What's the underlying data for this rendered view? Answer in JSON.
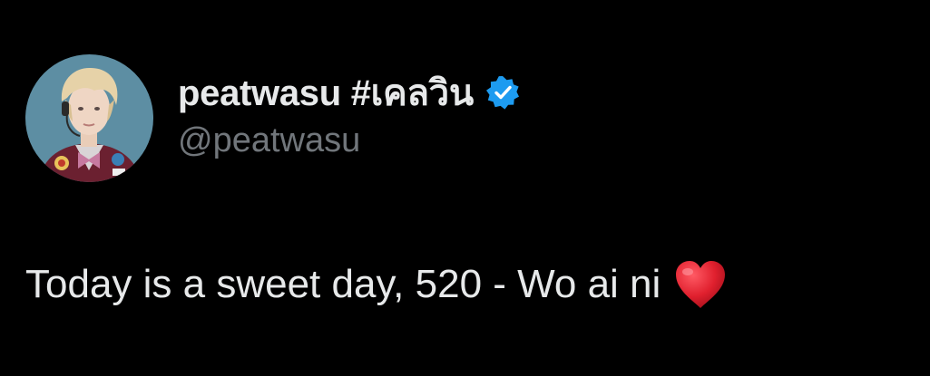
{
  "tweet": {
    "author": {
      "display_name": "peatwasu #เคลวิน",
      "handle": "@peatwasu",
      "verified": true,
      "avatar_icon": "profile-photo"
    },
    "text": "Today is a sweet day, 520 - Wo ai ni",
    "emoji": "heart-emoji"
  },
  "colors": {
    "background": "#000000",
    "primary_text": "#e7e9ea",
    "secondary_text": "#71767b",
    "verified_blue": "#1d9bf0",
    "heart_red": "#e0202e"
  }
}
